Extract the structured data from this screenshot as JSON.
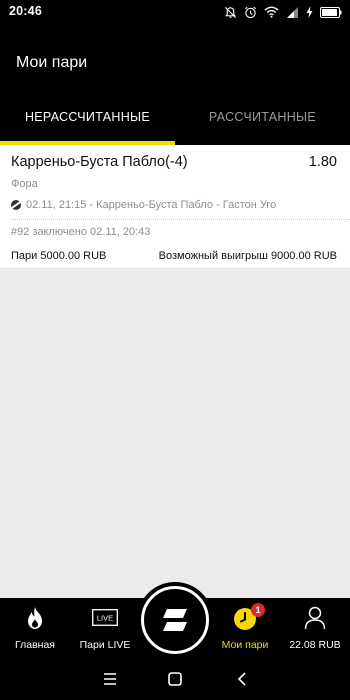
{
  "status_bar": {
    "time": "20:46",
    "icons": [
      "alarm-off-icon",
      "alarm-icon",
      "wifi-icon",
      "signal-icon",
      "charging-icon",
      "battery-icon"
    ]
  },
  "header": {
    "title": "Мои пари",
    "tabs": [
      {
        "label": "НЕРАССЧИТАННЫЕ",
        "active": true
      },
      {
        "label": "РАССЧИТАННЫЕ",
        "active": false
      }
    ],
    "accent_color": "#f4d80c"
  },
  "bets": [
    {
      "title": "Карреньо-Буста Пабло(-4)",
      "coefficient": "1.80",
      "type": "Фора",
      "sport_icon": "tennis-ball-icon",
      "event": "02.11, 21:15 - Карреньо-Буста Пабло - Гастон Уго",
      "bet_id": "#92 заключено 02.11, 20:43",
      "stake": "Пари 5000.00 RUB",
      "possible_win": "Возможный выигрыш 9000.00 RUB"
    }
  ],
  "bottom_nav": {
    "items": [
      {
        "label": "Главная",
        "icon": "flame-icon",
        "active": false
      },
      {
        "label": "Пари LIVE",
        "icon": "live-icon",
        "icon_text": "LIVE",
        "active": false
      },
      {
        "label": "Мои пари",
        "icon": "clock-icon",
        "active": true,
        "badge": "1"
      },
      {
        "label": "22.08 RUB",
        "icon": "user-icon",
        "active": false
      }
    ],
    "center_icon": "fonbet-logo-icon"
  },
  "system_nav": [
    "menu-icon",
    "home-icon",
    "back-icon"
  ]
}
